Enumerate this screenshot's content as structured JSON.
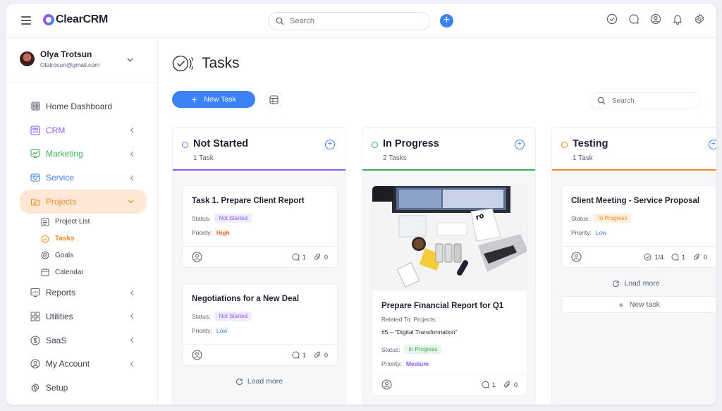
{
  "app": {
    "name": "ClearCRM"
  },
  "topbar": {
    "search_placeholder": "Search"
  },
  "user": {
    "name": "Olya Trotsun",
    "email": "Olatrocun@gmail.com"
  },
  "nav": {
    "home": "Home Dashboard",
    "crm": "CRM",
    "marketing": "Marketing",
    "service": "Service",
    "projects": "Projects",
    "projects_sub": [
      "Project List",
      "Tasks",
      "Goals",
      "Calendar"
    ],
    "reports": "Reports",
    "utilities": "Utilities",
    "saas": "SaaS",
    "account": "My Account",
    "setup": "Setup"
  },
  "page": {
    "title": "Tasks",
    "new_task": "New Task",
    "search_placeholder": "Search"
  },
  "columns": [
    {
      "title": "Not Started",
      "count": "1 Task",
      "color": "#8b5cf6",
      "cards": [
        {
          "title": "Task 1. Prepare Client Report",
          "status_label": "Status:",
          "status": "Not Started",
          "priority_label": "Priority:",
          "priority": "High",
          "comments": "1",
          "attachments": "0"
        },
        {
          "title": "Negotiations for a New Deal",
          "status_label": "Status:",
          "status": "Not Started",
          "priority_label": "Priority:",
          "priority": "Low",
          "comments": "1",
          "attachments": "0"
        }
      ],
      "load_more": "Load more"
    },
    {
      "title": "In Progress",
      "count": "2 Tasks",
      "color": "#3fae5a",
      "cards": [
        {
          "title": "Prepare Financial Report for Q1",
          "related_label": "Related To: Projects:",
          "related": "#5 – \"Digital Transformation\"",
          "status_label": "Status:",
          "status": "In Progress",
          "priority_label": "Priority:",
          "priority": "Medium",
          "comments": "1",
          "attachments": "0"
        }
      ]
    },
    {
      "title": "Testing",
      "count": "1 Task",
      "color": "#f08a24",
      "cards": [
        {
          "title": "Client Meeting - Service Proposal",
          "status_label": "Status:",
          "status": "In Progress",
          "priority_label": "Priority:",
          "priority": "Low",
          "checklist": "1/4",
          "comments": "1",
          "attachments": "0"
        }
      ],
      "load_more": "Load more",
      "new_task": "New task"
    }
  ]
}
